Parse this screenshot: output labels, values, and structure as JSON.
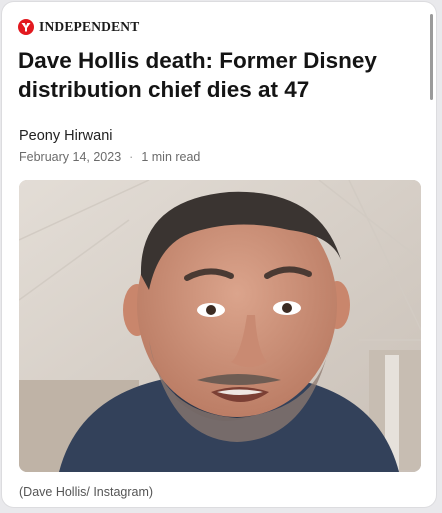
{
  "masthead": {
    "brand": "INDEPENDENT",
    "logo_icon": "eagle-logo-icon",
    "accent": "#e2191f"
  },
  "article": {
    "headline": "Dave Hollis death: Former Disney distribution chief dies at 47",
    "author": "Peony Hirwani",
    "date": "February 14, 2023",
    "separator": "·",
    "read_time": "1 min read"
  },
  "photo": {
    "caption": "(Dave Hollis/ Instagram)"
  }
}
